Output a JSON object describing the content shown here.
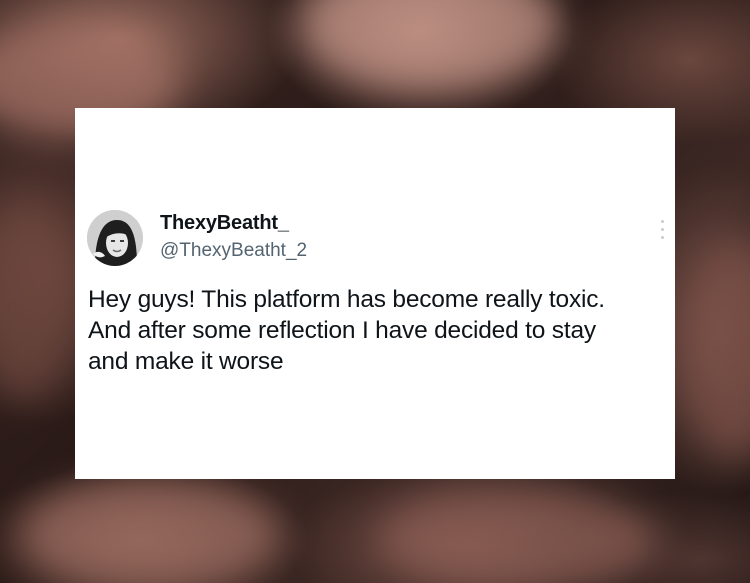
{
  "tweet": {
    "display_name": "ThexyBeatht_",
    "handle": "@ThexyBeatht_2",
    "text_lines": [
      "Hey guys! This platform has become really toxic.",
      "And after some reflection I have decided to stay",
      "and make it worse"
    ],
    "avatar_icon": "profile-photo",
    "more_icon": "more-options-icon"
  },
  "colors": {
    "card_background": "#ffffff",
    "name_color": "#0f1419",
    "handle_color": "#536471",
    "backdrop_tone": "#2a1a17"
  }
}
